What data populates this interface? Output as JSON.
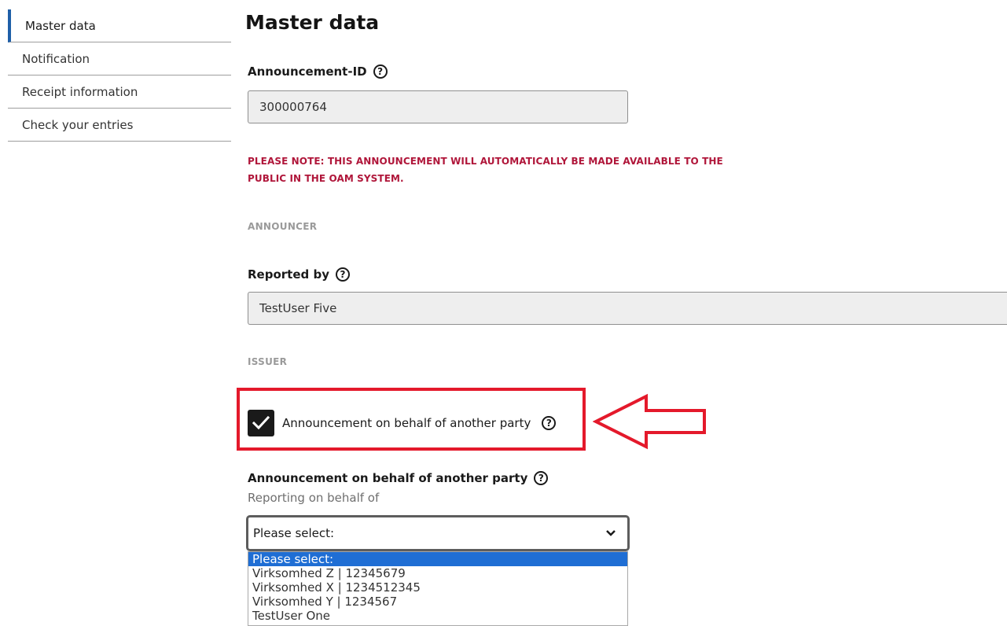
{
  "sidebar": {
    "items": [
      {
        "label": "Master data",
        "active": true
      },
      {
        "label": "Notification",
        "active": false
      },
      {
        "label": "Receipt information",
        "active": false
      },
      {
        "label": "Check your entries",
        "active": false
      }
    ]
  },
  "main": {
    "title": "Master data",
    "announcement_id": {
      "label": "Announcement-ID",
      "value": "300000764"
    },
    "notice_line1": "PLEASE NOTE: THIS ANNOUNCEMENT WILL AUTOMATICALLY BE MADE AVAILABLE TO THE",
    "notice_line2": "PUBLIC IN THE OAM SYSTEM.",
    "announcer_heading": "ANNOUNCER",
    "reported_by": {
      "label": "Reported by",
      "value": "TestUser Five"
    },
    "issuer_heading": "ISSUER",
    "on_behalf_checkbox": {
      "label": "Announcement on behalf of another party",
      "checked": true
    },
    "on_behalf_field": {
      "label": "Announcement on behalf of another party",
      "subtext": "Reporting on behalf of",
      "selected": "Please select:",
      "options": [
        "Please select:",
        "Virksomhed Z | 12345679",
        "Virksomhed X | 1234512345",
        "Virksomhed Y | 1234567",
        "TestUser One"
      ]
    }
  },
  "colors": {
    "accent": "#1f5fa8",
    "notice": "#b0163a",
    "annotation": "#e4192b",
    "selected_option": "#1f6ed4"
  },
  "icons": {
    "help": "help-icon",
    "checkmark": "checkmark-icon",
    "dropdown": "chevron-down-icon",
    "annotation_arrow": "arrow-left-icon"
  }
}
